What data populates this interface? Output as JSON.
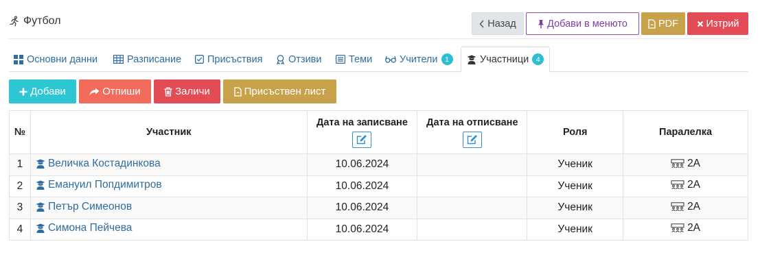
{
  "header": {
    "title": "Футбол",
    "title_icon": "running-person-icon",
    "back_label": "Назад",
    "add_to_menu_label": "Добави в менюто",
    "pdf_label": "PDF",
    "delete_label": "Изтрий"
  },
  "tabs": [
    {
      "label": "Основни данни",
      "icon": "grid-icon"
    },
    {
      "label": "Разписание",
      "icon": "calendar-table-icon"
    },
    {
      "label": "Присъствия",
      "icon": "checkbox-icon"
    },
    {
      "label": "Отзиви",
      "icon": "award-icon"
    },
    {
      "label": "Теми",
      "icon": "list-icon"
    },
    {
      "label": "Учители",
      "icon": "glasses-icon",
      "badge": "1"
    },
    {
      "label": "Участници",
      "icon": "graduate-icon",
      "badge": "4",
      "active": true
    }
  ],
  "toolbar": {
    "add_label": "Добави",
    "unsubscribe_label": "Отпиши",
    "delete_label": "Заличи",
    "attendance_sheet_label": "Присъствен лист"
  },
  "table": {
    "columns": [
      "№",
      "Участник",
      "Дата на записване",
      "Дата на отписване",
      "Роля",
      "Паралелка"
    ],
    "rows": [
      {
        "num": "1",
        "name": "Величка Костадинкова",
        "enrolled": "10.06.2024",
        "unenrolled": "",
        "role": "Ученик",
        "class": "2А"
      },
      {
        "num": "2",
        "name": "Емануил Попдимитров",
        "enrolled": "10.06.2024",
        "unenrolled": "",
        "role": "Ученик",
        "class": "2А"
      },
      {
        "num": "3",
        "name": "Петър Симеонов",
        "enrolled": "10.06.2024",
        "unenrolled": "",
        "role": "Ученик",
        "class": "2А"
      },
      {
        "num": "4",
        "name": "Симона Пейчева",
        "enrolled": "10.06.2024",
        "unenrolled": "",
        "role": "Ученик",
        "class": "2А"
      }
    ]
  },
  "colors": {
    "link": "#2f6ca0",
    "info": "#2cc7d3",
    "warning": "#f26b5b",
    "danger": "#e34c55",
    "gold": "#c8a24a",
    "purple": "#7b3fa5"
  }
}
